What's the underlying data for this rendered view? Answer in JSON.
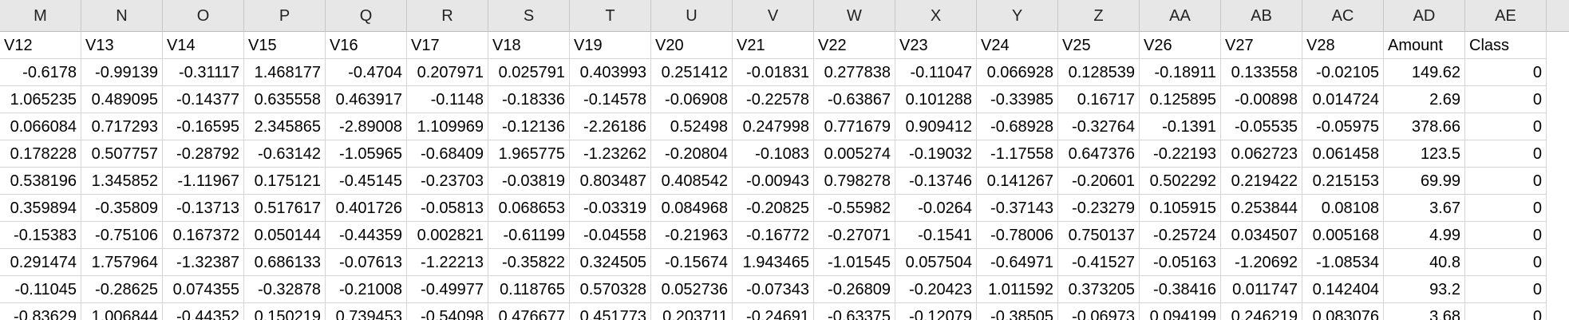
{
  "column_headers": [
    "M",
    "N",
    "O",
    "P",
    "Q",
    "R",
    "S",
    "T",
    "U",
    "V",
    "W",
    "X",
    "Y",
    "Z",
    "AA",
    "AB",
    "AC",
    "AD",
    "AE"
  ],
  "field_names": [
    "V12",
    "V13",
    "V14",
    "V15",
    "V16",
    "V17",
    "V18",
    "V19",
    "V20",
    "V21",
    "V22",
    "V23",
    "V24",
    "V25",
    "V26",
    "V27",
    "V28",
    "Amount",
    "Class"
  ],
  "rows": [
    [
      "-0.6178",
      "-0.99139",
      "-0.31117",
      "1.468177",
      "-0.4704",
      "0.207971",
      "0.025791",
      "0.403993",
      "0.251412",
      "-0.01831",
      "0.277838",
      "-0.11047",
      "0.066928",
      "0.128539",
      "-0.18911",
      "0.133558",
      "-0.02105",
      "149.62",
      "0"
    ],
    [
      "1.065235",
      "0.489095",
      "-0.14377",
      "0.635558",
      "0.463917",
      "-0.1148",
      "-0.18336",
      "-0.14578",
      "-0.06908",
      "-0.22578",
      "-0.63867",
      "0.101288",
      "-0.33985",
      "0.16717",
      "0.125895",
      "-0.00898",
      "0.014724",
      "2.69",
      "0"
    ],
    [
      "0.066084",
      "0.717293",
      "-0.16595",
      "2.345865",
      "-2.89008",
      "1.109969",
      "-0.12136",
      "-2.26186",
      "0.52498",
      "0.247998",
      "0.771679",
      "0.909412",
      "-0.68928",
      "-0.32764",
      "-0.1391",
      "-0.05535",
      "-0.05975",
      "378.66",
      "0"
    ],
    [
      "0.178228",
      "0.507757",
      "-0.28792",
      "-0.63142",
      "-1.05965",
      "-0.68409",
      "1.965775",
      "-1.23262",
      "-0.20804",
      "-0.1083",
      "0.005274",
      "-0.19032",
      "-1.17558",
      "0.647376",
      "-0.22193",
      "0.062723",
      "0.061458",
      "123.5",
      "0"
    ],
    [
      "0.538196",
      "1.345852",
      "-1.11967",
      "0.175121",
      "-0.45145",
      "-0.23703",
      "-0.03819",
      "0.803487",
      "0.408542",
      "-0.00943",
      "0.798278",
      "-0.13746",
      "0.141267",
      "-0.20601",
      "0.502292",
      "0.219422",
      "0.215153",
      "69.99",
      "0"
    ],
    [
      "0.359894",
      "-0.35809",
      "-0.13713",
      "0.517617",
      "0.401726",
      "-0.05813",
      "0.068653",
      "-0.03319",
      "0.084968",
      "-0.20825",
      "-0.55982",
      "-0.0264",
      "-0.37143",
      "-0.23279",
      "0.105915",
      "0.253844",
      "0.08108",
      "3.67",
      "0"
    ],
    [
      "-0.15383",
      "-0.75106",
      "0.167372",
      "0.050144",
      "-0.44359",
      "0.002821",
      "-0.61199",
      "-0.04558",
      "-0.21963",
      "-0.16772",
      "-0.27071",
      "-0.1541",
      "-0.78006",
      "0.750137",
      "-0.25724",
      "0.034507",
      "0.005168",
      "4.99",
      "0"
    ],
    [
      "0.291474",
      "1.757964",
      "-1.32387",
      "0.686133",
      "-0.07613",
      "-1.22213",
      "-0.35822",
      "0.324505",
      "-0.15674",
      "1.943465",
      "-1.01545",
      "0.057504",
      "-0.64971",
      "-0.41527",
      "-0.05163",
      "-1.20692",
      "-1.08534",
      "40.8",
      "0"
    ],
    [
      "-0.11045",
      "-0.28625",
      "0.074355",
      "-0.32878",
      "-0.21008",
      "-0.49977",
      "0.118765",
      "0.570328",
      "0.052736",
      "-0.07343",
      "-0.26809",
      "-0.20423",
      "1.011592",
      "0.373205",
      "-0.38416",
      "0.011747",
      "0.142404",
      "93.2",
      "0"
    ],
    [
      "-0.83629",
      "1.006844",
      "-0.44352",
      "0.150219",
      "0.739453",
      "-0.54098",
      "0.476677",
      "0.451773",
      "0.203711",
      "-0.24691",
      "-0.63375",
      "-0.12079",
      "-0.38505",
      "-0.06973",
      "0.094199",
      "0.246219",
      "0.083076",
      "3.68",
      "0"
    ]
  ]
}
